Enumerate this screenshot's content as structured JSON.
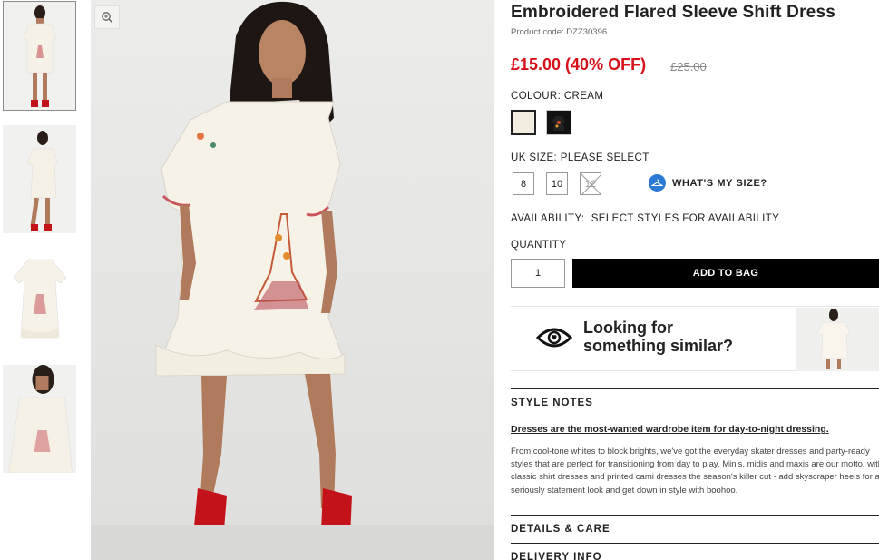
{
  "product": {
    "title": "Embroidered Flared Sleeve Shift Dress",
    "code": "Product code: DZZ30396",
    "price": "£15.00 (40% OFF)",
    "old_price": "£25.00"
  },
  "colour": {
    "label": "COLOUR:",
    "value": "CREAM",
    "options": [
      "cream",
      "black"
    ]
  },
  "size": {
    "label": "UK SIZE:",
    "value": "PLEASE SELECT",
    "options": [
      "8",
      "10",
      "12"
    ],
    "guide": "WHAT'S MY SIZE?"
  },
  "availability": {
    "label": "AVAILABILITY:",
    "value": "SELECT STYLES FOR AVAILABILITY"
  },
  "quantity": {
    "label": "QUANTITY",
    "value": "1"
  },
  "add_to_bag": "ADD TO BAG",
  "similar": {
    "line1": "Looking for",
    "line2": "something similar?"
  },
  "style_notes": {
    "heading": "STYLE NOTES",
    "link": "Dresses are the most-wanted wardrobe item for day-to-night dressing.",
    "body": "From cool-tone whites to block brights, we've got the everyday skater dresses and party-ready styles that are perfect for transitioning from day to play. Minis, midis and maxis are our motto, with classic shirt dresses and printed cami dresses the season's killer cut - add skyscraper heels for a seriously statement look and get down in style with boohoo."
  },
  "details_care": "DETAILS & CARE",
  "delivery_info": "DELIVERY INFO",
  "colors": {
    "sale_red": "#d6111b",
    "accent_blue": "#2b7bd6",
    "button_black": "#000000"
  },
  "icons": [
    "zoom-icon",
    "hanger-icon",
    "eye-icon"
  ]
}
